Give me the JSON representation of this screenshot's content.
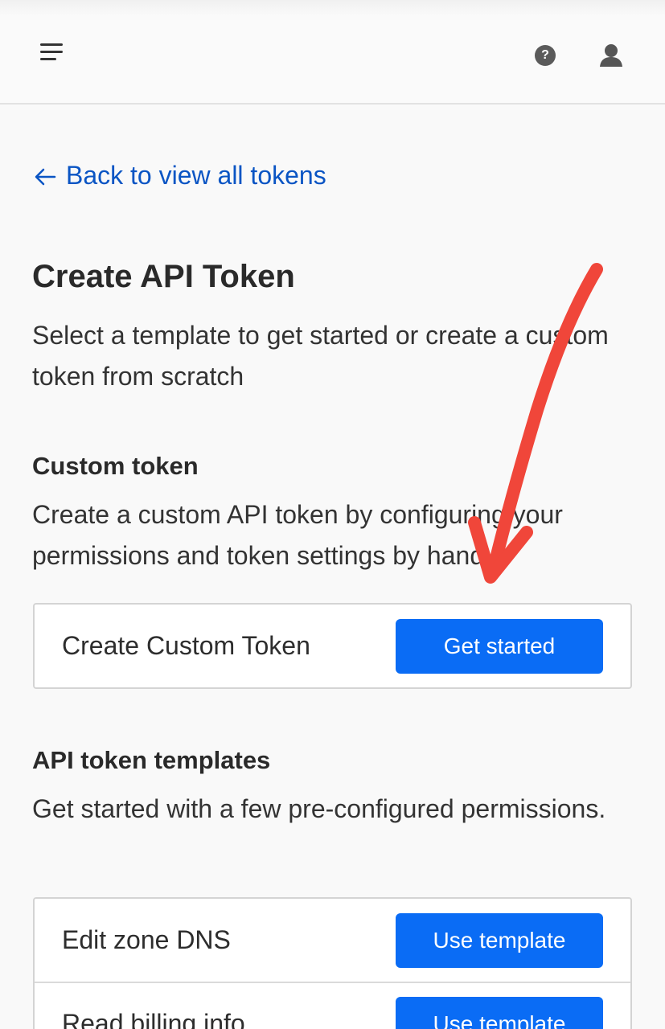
{
  "header": {
    "menu_icon": "hamburger-menu-icon",
    "help_icon": "question-circle-icon",
    "help_glyph": "?",
    "user_icon": "user-avatar-icon"
  },
  "back_link": {
    "label": "Back to view all tokens",
    "icon": "arrow-left-icon"
  },
  "page": {
    "title": "Create API Token",
    "description": "Select a template to get started or create a custom token from scratch"
  },
  "custom_token": {
    "title": "Custom token",
    "description": "Create a custom API token by configuring your permissions and token settings by hand.",
    "row_label": "Create Custom Token",
    "button_label": "Get started"
  },
  "templates": {
    "title": "API token templates",
    "description": "Get started with a few pre-configured permissions.",
    "items": [
      {
        "label": "Edit zone DNS",
        "button_label": "Use template"
      },
      {
        "label": "Read billing info",
        "button_label": "Use template"
      }
    ]
  },
  "colors": {
    "link": "#0a55c4",
    "primary_button": "#0a6cf5",
    "annotation_arrow": "#f0463a"
  },
  "annotation": {
    "icon": "red-hand-drawn-arrow-icon"
  }
}
